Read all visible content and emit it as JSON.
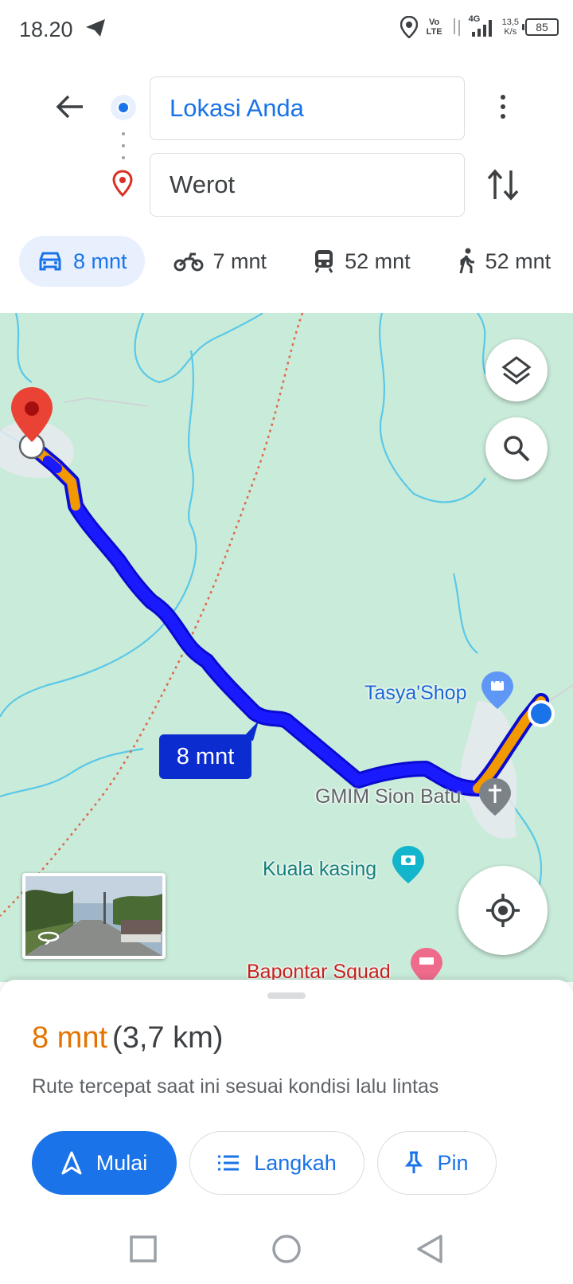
{
  "status_bar": {
    "time": "18.20",
    "volte": "Vo LTE",
    "network": "4G",
    "speed_value": "13,5",
    "speed_unit": "K/s",
    "battery": "85"
  },
  "header": {
    "origin": "Lokasi Anda",
    "destination": "Werot",
    "modes": [
      {
        "icon": "car-icon",
        "label": "8 mnt",
        "active": true
      },
      {
        "icon": "motorcycle-icon",
        "label": "7 mnt",
        "active": false
      },
      {
        "icon": "train-icon",
        "label": "52 mnt",
        "active": false
      },
      {
        "icon": "walk-icon",
        "label": "52 mnt",
        "active": false
      }
    ]
  },
  "map": {
    "route_duration": "8 mnt",
    "places": [
      "Tasya'Shop",
      "GMIM Sion Batu",
      "Kuala kasing",
      "Bapontar Squad"
    ],
    "colors": {
      "route": "#1a1aff",
      "traffic": "#f29900",
      "land": "#c9ebd9",
      "river": "#5ac8e8"
    }
  },
  "sheet": {
    "duration": "8 mnt",
    "distance": "(3,7 km)",
    "description": "Rute tercepat saat ini sesuai kondisi lalu lintas",
    "buttons": {
      "start": "Mulai",
      "steps": "Langkah",
      "pin": "Pin"
    }
  }
}
